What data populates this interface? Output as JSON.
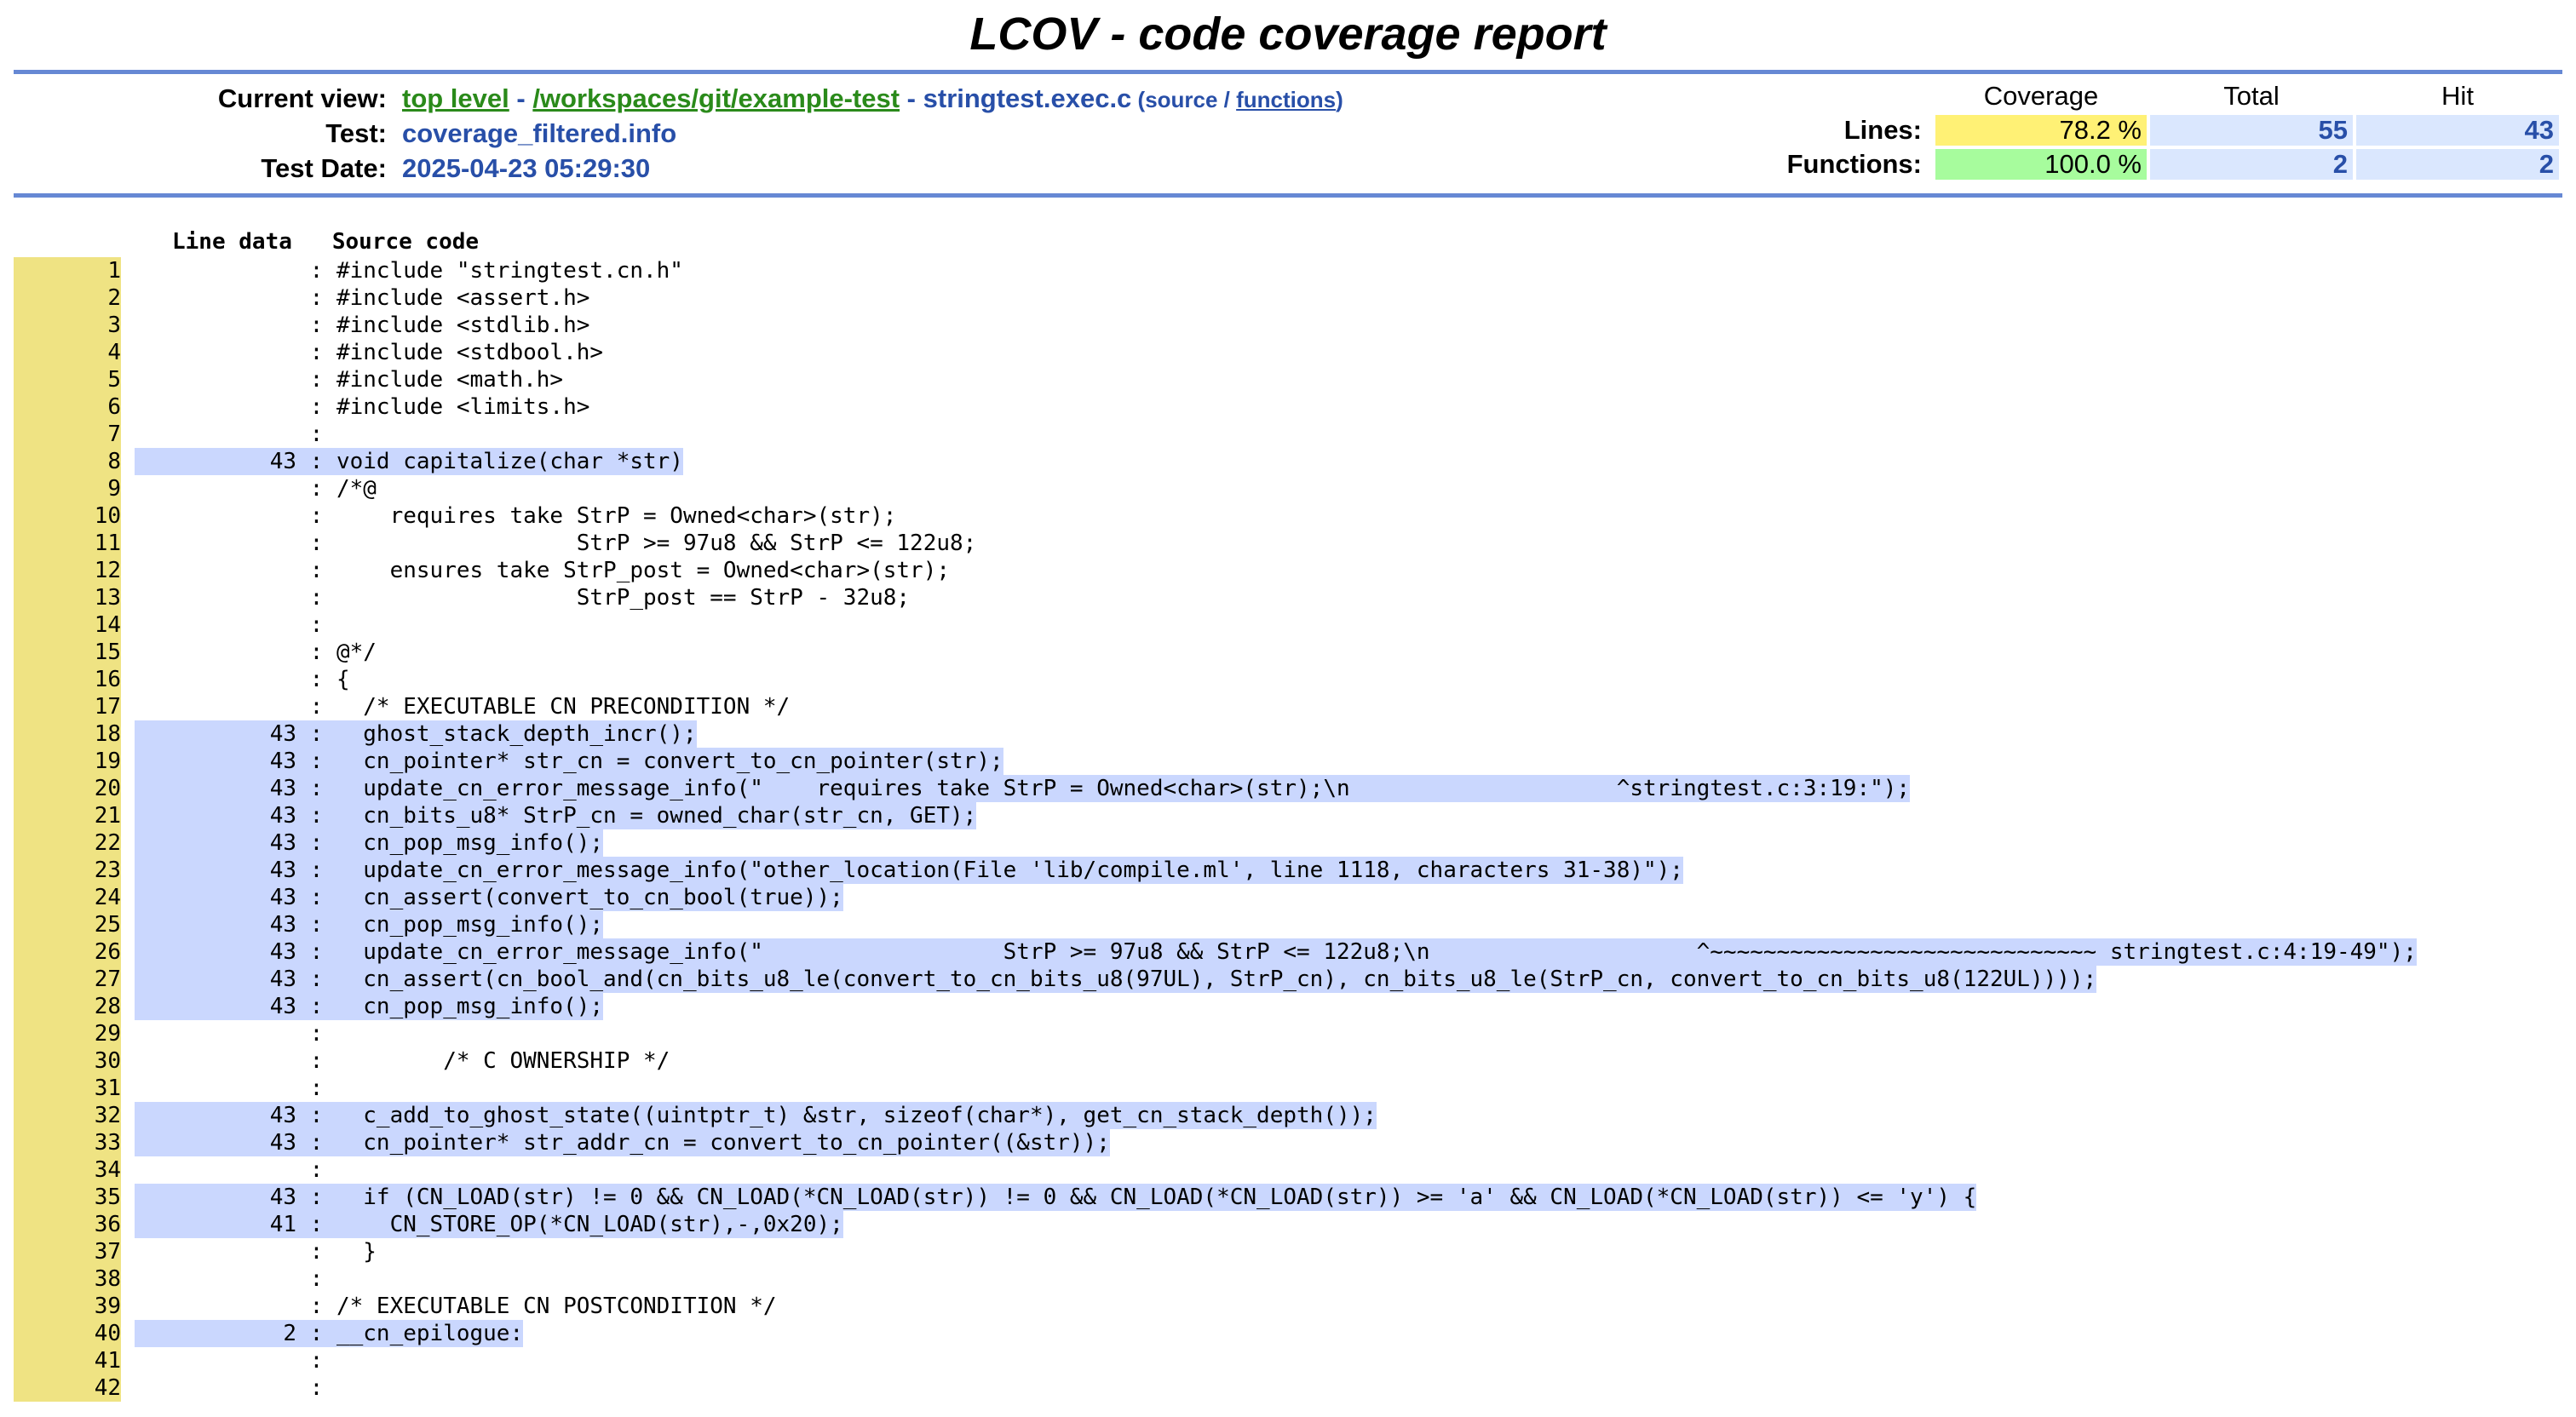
{
  "title": "LCOV - code coverage report",
  "header": {
    "current_view_label": "Current view:",
    "nav_top": "top level",
    "nav_sep1": " - ",
    "nav_path": "/workspaces/git/example-test",
    "nav_sep2": " - ",
    "nav_file": "stringtest.exec.c",
    "view_open": " (",
    "view_source": "source",
    "view_slash": " / ",
    "view_functions": "functions",
    "view_close": ")",
    "test_label": "Test:",
    "test_value": "coverage_filtered.info",
    "date_label": "Test Date:",
    "date_value": "2025-04-23 05:29:30"
  },
  "stats": {
    "col_coverage": "Coverage",
    "col_total": "Total",
    "col_hit": "Hit",
    "lines_label": "Lines:",
    "lines_coverage": "78.2 %",
    "lines_total": "55",
    "lines_hit": "43",
    "functions_label": "Functions:",
    "functions_coverage": "100.0 %",
    "functions_total": "2",
    "functions_hit": "2"
  },
  "columns": {
    "line_data": "Line data",
    "source_code": "Source code"
  },
  "colors": {
    "rule": "#6688d4",
    "line_number_bg": "#efe383",
    "hit_bg": "#cad7fe",
    "coverage_medium": "#fff175",
    "coverage_high": "#a7fc9d"
  },
  "lines": [
    {
      "n": "1",
      "c": "",
      "t": "#include \"stringtest.cn.h\""
    },
    {
      "n": "2",
      "c": "",
      "t": "#include <assert.h>"
    },
    {
      "n": "3",
      "c": "",
      "t": "#include <stdlib.h>"
    },
    {
      "n": "4",
      "c": "",
      "t": "#include <stdbool.h>"
    },
    {
      "n": "5",
      "c": "",
      "t": "#include <math.h>"
    },
    {
      "n": "6",
      "c": "",
      "t": "#include <limits.h>"
    },
    {
      "n": "7",
      "c": "",
      "t": ""
    },
    {
      "n": "8",
      "c": "43",
      "t": "void capitalize(char *str)"
    },
    {
      "n": "9",
      "c": "",
      "t": "/*@"
    },
    {
      "n": "10",
      "c": "",
      "t": "    requires take StrP = Owned<char>(str);"
    },
    {
      "n": "11",
      "c": "",
      "t": "                  StrP >= 97u8 && StrP <= 122u8;"
    },
    {
      "n": "12",
      "c": "",
      "t": "    ensures take StrP_post = Owned<char>(str);"
    },
    {
      "n": "13",
      "c": "",
      "t": "                  StrP_post == StrP - 32u8;"
    },
    {
      "n": "14",
      "c": "",
      "t": ""
    },
    {
      "n": "15",
      "c": "",
      "t": "@*/"
    },
    {
      "n": "16",
      "c": "",
      "t": "{"
    },
    {
      "n": "17",
      "c": "",
      "t": "  /* EXECUTABLE CN PRECONDITION */"
    },
    {
      "n": "18",
      "c": "43",
      "t": "  ghost_stack_depth_incr();"
    },
    {
      "n": "19",
      "c": "43",
      "t": "  cn_pointer* str_cn = convert_to_cn_pointer(str);"
    },
    {
      "n": "20",
      "c": "43",
      "t": "  update_cn_error_message_info(\"    requires take StrP = Owned<char>(str);\\n                    ^stringtest.c:3:19:\");"
    },
    {
      "n": "21",
      "c": "43",
      "t": "  cn_bits_u8* StrP_cn = owned_char(str_cn, GET);"
    },
    {
      "n": "22",
      "c": "43",
      "t": "  cn_pop_msg_info();"
    },
    {
      "n": "23",
      "c": "43",
      "t": "  update_cn_error_message_info(\"other_location(File 'lib/compile.ml', line 1118, characters 31-38)\");"
    },
    {
      "n": "24",
      "c": "43",
      "t": "  cn_assert(convert_to_cn_bool(true));"
    },
    {
      "n": "25",
      "c": "43",
      "t": "  cn_pop_msg_info();"
    },
    {
      "n": "26",
      "c": "43",
      "t": "  update_cn_error_message_info(\"                  StrP >= 97u8 && StrP <= 122u8;\\n                    ^~~~~~~~~~~~~~~~~~~~~~~~~~~~~~ stringtest.c:4:19-49\");"
    },
    {
      "n": "27",
      "c": "43",
      "t": "  cn_assert(cn_bool_and(cn_bits_u8_le(convert_to_cn_bits_u8(97UL), StrP_cn), cn_bits_u8_le(StrP_cn, convert_to_cn_bits_u8(122UL))));"
    },
    {
      "n": "28",
      "c": "43",
      "t": "  cn_pop_msg_info();"
    },
    {
      "n": "29",
      "c": "",
      "t": ""
    },
    {
      "n": "30",
      "c": "",
      "t": "        /* C OWNERSHIP */"
    },
    {
      "n": "31",
      "c": "",
      "t": ""
    },
    {
      "n": "32",
      "c": "43",
      "t": "  c_add_to_ghost_state((uintptr_t) &str, sizeof(char*), get_cn_stack_depth());"
    },
    {
      "n": "33",
      "c": "43",
      "t": "  cn_pointer* str_addr_cn = convert_to_cn_pointer((&str));"
    },
    {
      "n": "34",
      "c": "",
      "t": ""
    },
    {
      "n": "35",
      "c": "43",
      "t": "  if (CN_LOAD(str) != 0 && CN_LOAD(*CN_LOAD(str)) != 0 && CN_LOAD(*CN_LOAD(str)) >= 'a' && CN_LOAD(*CN_LOAD(str)) <= 'y') {"
    },
    {
      "n": "36",
      "c": "41",
      "t": "    CN_STORE_OP(*CN_LOAD(str),-,0x20);"
    },
    {
      "n": "37",
      "c": "",
      "t": "  }"
    },
    {
      "n": "38",
      "c": "",
      "t": ""
    },
    {
      "n": "39",
      "c": "",
      "t": "/* EXECUTABLE CN POSTCONDITION */"
    },
    {
      "n": "40",
      "c": "2",
      "t": "__cn_epilogue:"
    },
    {
      "n": "41",
      "c": "",
      "t": ""
    },
    {
      "n": "42",
      "c": "",
      "t": ""
    }
  ]
}
